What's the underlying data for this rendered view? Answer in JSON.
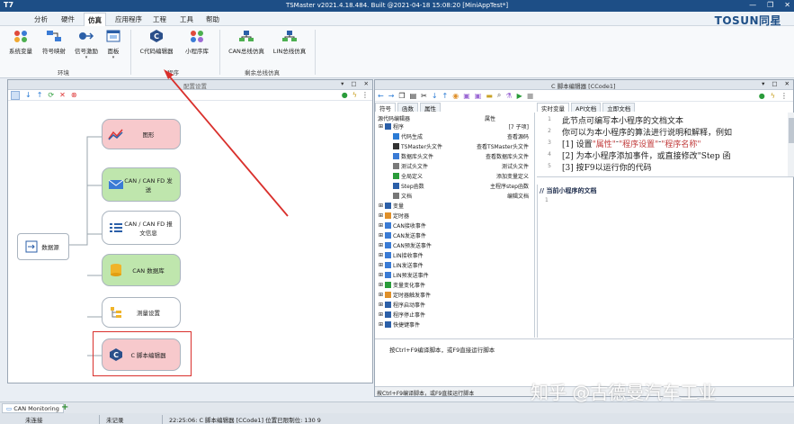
{
  "window": {
    "logo": "T7",
    "title": "TSMaster v2021.4.18.484. Built @2021-04-18 15:08:20 [MiniAppTest*]",
    "controls": [
      "—",
      "❐",
      "✕"
    ]
  },
  "menu": {
    "items": [
      "分析",
      "硬件",
      "仿真",
      "应用程序",
      "工程",
      "工具",
      "帮助"
    ],
    "active_index": 2,
    "brand": "TOSUN同星"
  },
  "ribbon": {
    "buttons": [
      {
        "label": "系统变量",
        "icon": "system-variable-icon"
      },
      {
        "label": "符号映射",
        "icon": "symbol-mapping-icon"
      },
      {
        "label": "信号激励",
        "icon": "signal-stimulus-icon",
        "arrow": "▾"
      },
      {
        "label": "面板",
        "icon": "panel-icon",
        "arrow": "▾"
      },
      {
        "label": "C代码编辑器",
        "icon": "c-code-editor-icon"
      },
      {
        "label": "小程序库",
        "icon": "mini-program-library-icon"
      },
      {
        "label": "CAN总线仿真",
        "icon": "can-bus-simulation-icon"
      },
      {
        "label": "LIN总线仿真",
        "icon": "lin-bus-simulation-icon"
      }
    ],
    "groups": [
      "环境",
      "程序",
      "剩余总线仿真"
    ]
  },
  "left_panel": {
    "title": "配置设置",
    "tool_icons": [
      "select-icon",
      "down-icon",
      "up-icon",
      "refresh-icon",
      "delete-icon",
      "stop-icon"
    ],
    "nodes": [
      {
        "label": "图形",
        "icon": "graph-icon"
      },
      {
        "label": "CAN / CAN FD 发送",
        "icon": "can-send-icon"
      },
      {
        "label": "CAN / CAN FD 报文信息",
        "icon": "can-message-info-icon"
      },
      {
        "label": "CAN 数据库",
        "icon": "can-database-icon"
      },
      {
        "label": "测量设置",
        "icon": "measurement-setup-icon"
      },
      {
        "label": "C 脚本编辑器",
        "icon": "c-script-editor-icon"
      }
    ],
    "source": {
      "label": "数据源",
      "icon": "data-source-icon"
    }
  },
  "right_panel": {
    "title": "C 脚本编辑器 [CCode1]",
    "left_tabs": [
      "符号",
      "函数",
      "属性"
    ],
    "right_tabs": [
      "实时变量",
      "API文档",
      "立即文档"
    ],
    "tree_header": "源代码编辑器",
    "tree_header_value": "属性",
    "program_value": "[7 子项]",
    "tree": [
      {
        "label": "程序",
        "value": "",
        "level": 0,
        "icon": "program-icon"
      },
      {
        "label": "代码生成",
        "value": "查看源码",
        "level": 1,
        "icon": "code-gen-icon"
      },
      {
        "label": "TSMaster头文件",
        "value": "查看TSMaster头文件",
        "level": 1,
        "icon": "header-icon"
      },
      {
        "label": "数据库头文件",
        "value": "查看数据库头文件",
        "level": 1,
        "icon": "db-header-icon"
      },
      {
        "label": "测试头文件",
        "value": "测试头文件",
        "level": 1,
        "icon": "test-header-icon"
      },
      {
        "label": "全局定义",
        "value": "添加变量定义",
        "level": 1,
        "icon": "global-def-icon"
      },
      {
        "label": "Step函数",
        "value": "主程序step函数",
        "level": 1,
        "icon": "step-func-icon"
      },
      {
        "label": "文档",
        "value": "编辑文档",
        "level": 1,
        "icon": "doc-icon"
      },
      {
        "label": "变量",
        "value": "",
        "level": 0,
        "icon": "variable-icon"
      },
      {
        "label": "定时器",
        "value": "",
        "level": 0,
        "icon": "timer-icon"
      },
      {
        "label": "CAN接收事件",
        "value": "",
        "level": 0,
        "icon": "can-rx-icon"
      },
      {
        "label": "CAN发送事件",
        "value": "",
        "level": 0,
        "icon": "can-tx-icon"
      },
      {
        "label": "CAN预发送事件",
        "value": "",
        "level": 0,
        "icon": "can-pretx-icon"
      },
      {
        "label": "LIN接收事件",
        "value": "",
        "level": 0,
        "icon": "lin-rx-icon"
      },
      {
        "label": "LIN发送事件",
        "value": "",
        "level": 0,
        "icon": "lin-tx-icon"
      },
      {
        "label": "LIN预发送事件",
        "value": "",
        "level": 0,
        "icon": "lin-pretx-icon"
      },
      {
        "label": "变量变化事件",
        "value": "",
        "level": 0,
        "icon": "var-change-icon"
      },
      {
        "label": "定时器触发事件",
        "value": "",
        "level": 0,
        "icon": "timer-event-icon"
      },
      {
        "label": "程序启动事件",
        "value": "",
        "level": 0,
        "icon": "start-icon"
      },
      {
        "label": "程序停止事件",
        "value": "",
        "level": 0,
        "icon": "stop-icon"
      },
      {
        "label": "快捷键事件",
        "value": "",
        "level": 0,
        "icon": "hotkey-icon"
      }
    ],
    "doc_lines": [
      {
        "n": "1",
        "text": "此节点可编写本小程序的文档文本"
      },
      {
        "n": "2",
        "text": "你可以为本小程序的算法进行说明和解释，例如"
      },
      {
        "n": "3",
        "pre": "[1] 设置",
        "hl1": "\"属性\"",
        "mid": " - ",
        "hl2": "\"程序设置\"",
        "mid2": " - ",
        "hl3": "\"程序名称\""
      },
      {
        "n": "4",
        "text": "[2] 为本小程序添加事件，或直接修改\"Step 函"
      },
      {
        "n": "5",
        "text": "[3] 按F9以运行你的代码"
      }
    ],
    "code_comment": "// 当前小程序的文档",
    "code_line_number": "1",
    "message": "按Ctrl+F9编译脚本，或F9直接运行脚本",
    "footer": "按Ctrl+F9编译脚本，或F9直接运行脚本"
  },
  "bottom": {
    "tab": "CAN Monitoring",
    "add": "+",
    "status": [
      "未连接",
      "未记录",
      "22:25:06: C 脚本编辑器 [CCode1] 位置已限制位: 130 9"
    ]
  },
  "watermark": "知乎 @古德曼汽车工业"
}
